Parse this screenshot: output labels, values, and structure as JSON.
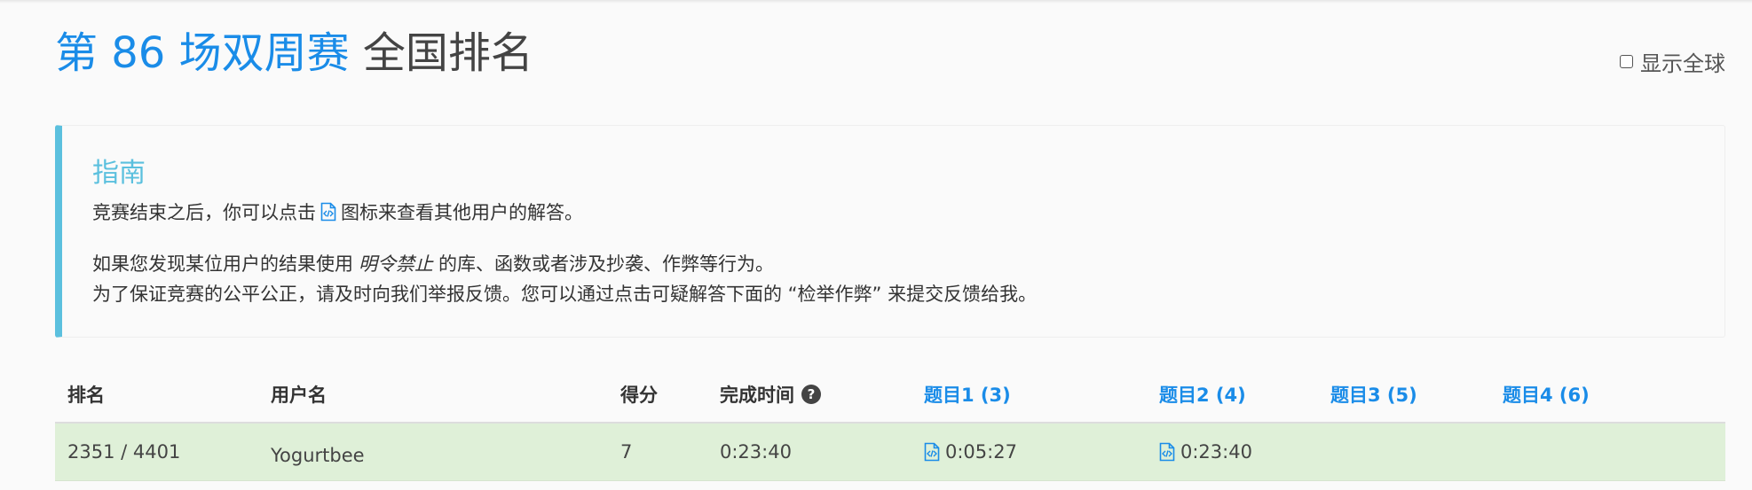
{
  "header": {
    "contest_link": "第 86 场双周赛",
    "title_rest": "全国排名",
    "show_global_label": "显示全球"
  },
  "guide": {
    "title": "指南",
    "line1_before": "竞赛结束之后，你可以点击",
    "line1_after": "图标来查看其他用户的解答。",
    "line2_before": "如果您发现某位用户的结果使用",
    "line2_em": "明令禁止",
    "line2_after": "的库、函数或者涉及抄袭、作弊等行为。",
    "line3": "为了保证竞赛的公平公正，请及时向我们举报反馈。您可以通过点击可疑解答下面的 “检举作弊” 来提交反馈给我。"
  },
  "table": {
    "headers": {
      "rank": "排名",
      "username": "用户名",
      "score": "得分",
      "finish_time": "完成时间",
      "p1": "题目1 (3)",
      "p2": "题目2 (4)",
      "p3": "题目3 (5)",
      "p4": "题目4 (6)"
    },
    "rows": [
      {
        "rank": "2351 / 4401",
        "username": "Yogurtbee",
        "score": "7",
        "finish_time": "0:23:40",
        "p1": "0:05:27",
        "p2": "0:23:40",
        "p3": "",
        "p4": ""
      }
    ]
  },
  "colors": {
    "link": "#1a8ce8",
    "info_accent": "#5bc0de",
    "success_row": "#dff0d8"
  },
  "icons": {
    "code": "code-file-icon",
    "help": "question-circle-icon"
  }
}
